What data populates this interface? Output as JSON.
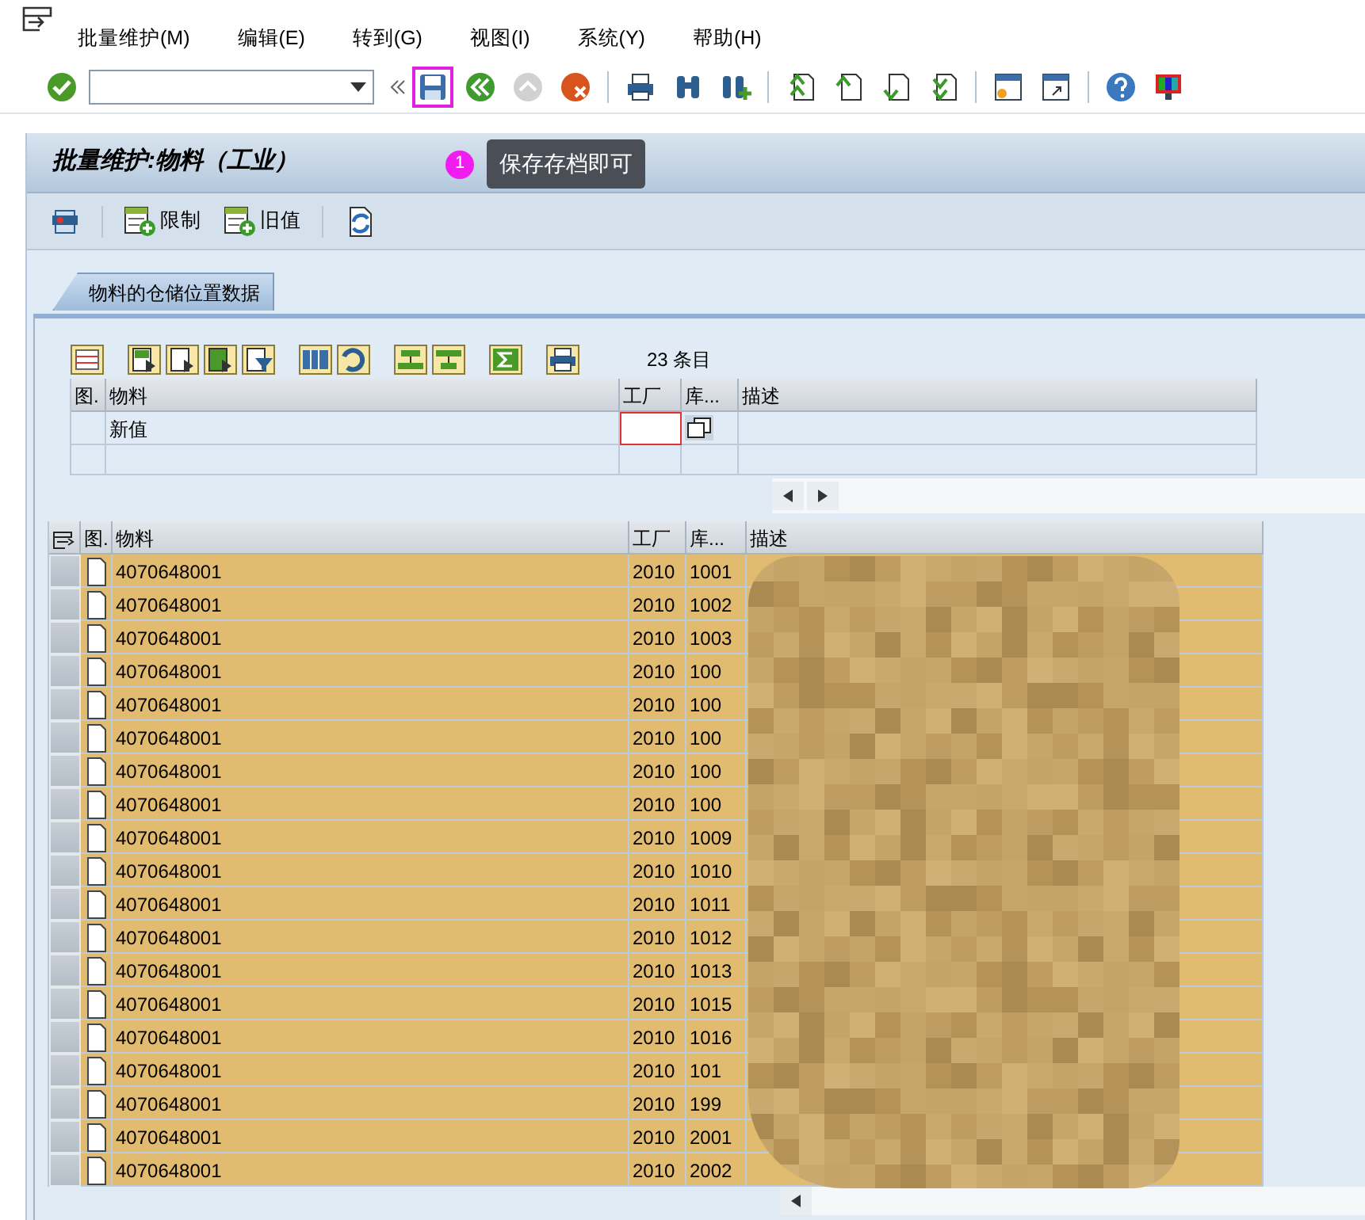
{
  "menu": [
    "批量维护(M)",
    "编辑(E)",
    "转到(G)",
    "视图(I)",
    "系统(Y)",
    "帮助(H)"
  ],
  "system_toolbar": [
    {
      "kind": "ok",
      "disabled": false,
      "highlighted": false
    },
    {
      "kind": "command-field"
    },
    {
      "kind": "save",
      "disabled": false,
      "highlighted": true
    },
    {
      "kind": "back",
      "disabled": false,
      "highlighted": false
    },
    {
      "kind": "exit",
      "disabled": true,
      "highlighted": false
    },
    {
      "kind": "cancel",
      "disabled": false,
      "highlighted": false
    },
    {
      "kind": "sep"
    },
    {
      "kind": "print",
      "disabled": false,
      "highlighted": false
    },
    {
      "kind": "find",
      "disabled": false,
      "highlighted": false
    },
    {
      "kind": "find-next",
      "disabled": false,
      "highlighted": false
    },
    {
      "kind": "sep"
    },
    {
      "kind": "first-page",
      "disabled": false,
      "highlighted": false
    },
    {
      "kind": "prev-page",
      "disabled": false,
      "highlighted": false
    },
    {
      "kind": "next-page",
      "disabled": false,
      "highlighted": false
    },
    {
      "kind": "last-page",
      "disabled": false,
      "highlighted": false
    },
    {
      "kind": "sep"
    },
    {
      "kind": "new-session",
      "disabled": false,
      "highlighted": false
    },
    {
      "kind": "shortcut",
      "disabled": false,
      "highlighted": false
    },
    {
      "kind": "sep"
    },
    {
      "kind": "help",
      "disabled": false,
      "highlighted": false
    },
    {
      "kind": "layout",
      "disabled": false,
      "highlighted": false
    }
  ],
  "title": "批量维护:物料（工业）",
  "callout": {
    "number": "1",
    "text": "保存存档即可"
  },
  "app_toolbar": [
    {
      "kind": "overview"
    },
    {
      "kind": "sep"
    },
    {
      "kind": "add",
      "label": "限制"
    },
    {
      "kind": "add",
      "label": "旧值"
    },
    {
      "kind": "sep"
    },
    {
      "kind": "refresh"
    }
  ],
  "tab": {
    "label": "物料的仓储位置数据",
    "selected": true
  },
  "alv_toolbar": [
    {
      "kind": "details"
    },
    {
      "kind": "gap"
    },
    {
      "kind": "select-all"
    },
    {
      "kind": "deselect"
    },
    {
      "kind": "select-block"
    },
    {
      "kind": "filter"
    },
    {
      "kind": "gap"
    },
    {
      "kind": "columns"
    },
    {
      "kind": "undo"
    },
    {
      "kind": "gap"
    },
    {
      "kind": "sort-up"
    },
    {
      "kind": "sort-down"
    },
    {
      "kind": "gap"
    },
    {
      "kind": "sum"
    },
    {
      "kind": "gap"
    },
    {
      "kind": "print"
    }
  ],
  "entries": "23 条目",
  "new_values_table": {
    "columns": [
      "图.",
      "物料",
      "工厂",
      "库...",
      "描述"
    ],
    "row_label": "新值"
  },
  "table": {
    "columns": [
      "图.",
      "物料",
      "工厂",
      "库...",
      "描述"
    ],
    "rows": [
      {
        "material": "4070648001",
        "plant": "2010",
        "storage": "1001"
      },
      {
        "material": "4070648001",
        "plant": "2010",
        "storage": "1002"
      },
      {
        "material": "4070648001",
        "plant": "2010",
        "storage": "1003"
      },
      {
        "material": "4070648001",
        "plant": "2010",
        "storage": "100"
      },
      {
        "material": "4070648001",
        "plant": "2010",
        "storage": "100"
      },
      {
        "material": "4070648001",
        "plant": "2010",
        "storage": "100"
      },
      {
        "material": "4070648001",
        "plant": "2010",
        "storage": "100"
      },
      {
        "material": "4070648001",
        "plant": "2010",
        "storage": "100"
      },
      {
        "material": "4070648001",
        "plant": "2010",
        "storage": "1009"
      },
      {
        "material": "4070648001",
        "plant": "2010",
        "storage": "1010"
      },
      {
        "material": "4070648001",
        "plant": "2010",
        "storage": "1011"
      },
      {
        "material": "4070648001",
        "plant": "2010",
        "storage": "1012"
      },
      {
        "material": "4070648001",
        "plant": "2010",
        "storage": "1013"
      },
      {
        "material": "4070648001",
        "plant": "2010",
        "storage": "1015"
      },
      {
        "material": "4070648001",
        "plant": "2010",
        "storage": "1016"
      },
      {
        "material": "4070648001",
        "plant": "2010",
        "storage": "101"
      },
      {
        "material": "4070648001",
        "plant": "2010",
        "storage": "199"
      },
      {
        "material": "4070648001",
        "plant": "2010",
        "storage": "2001"
      },
      {
        "material": "4070648001",
        "plant": "2010",
        "storage": "2002"
      }
    ]
  }
}
